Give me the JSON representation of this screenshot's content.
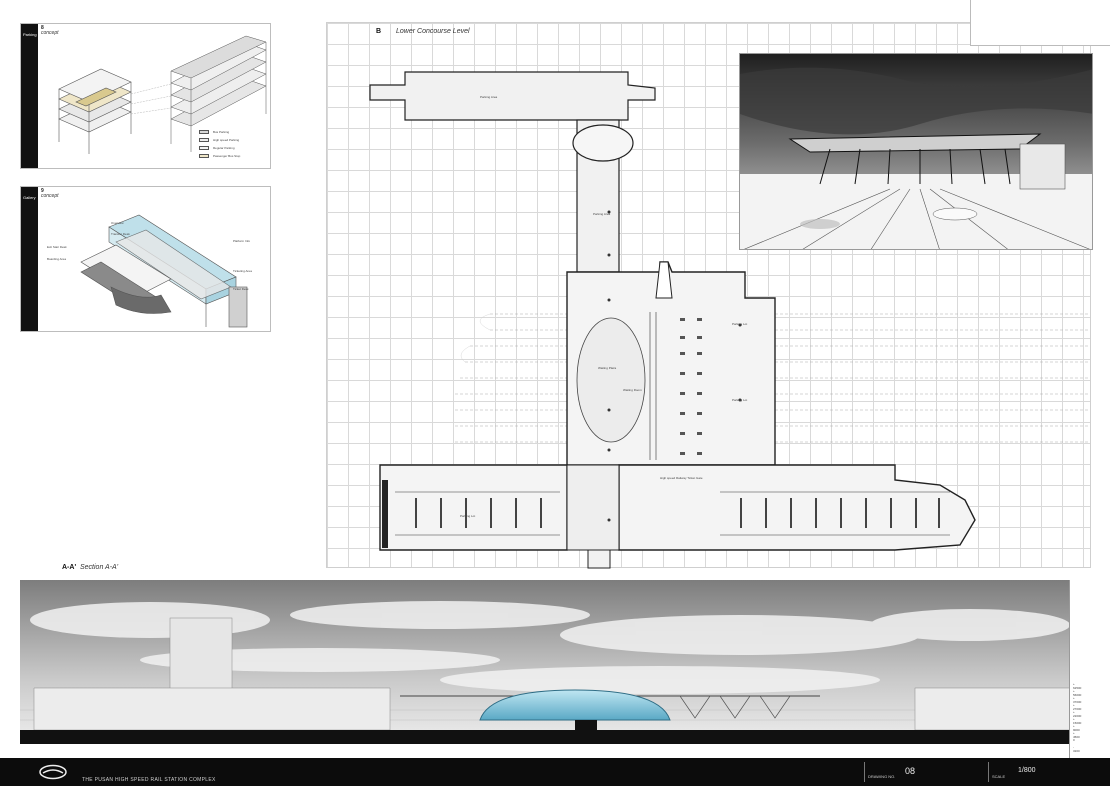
{
  "panels": {
    "parking": {
      "num": "8",
      "title": "Parking",
      "title_sub": "concept",
      "legend": [
        {
          "label": "Bus Parking",
          "color": "#d8d8d8"
        },
        {
          "label": "High speed Parking",
          "color": "#eeeeee"
        },
        {
          "label": "Regular Parking",
          "color": "#f4f4f4"
        },
        {
          "label": "Passenger Bus Stop",
          "color": "#efe6c8"
        }
      ]
    },
    "gallery": {
      "num": "9",
      "title": "Gallery",
      "title_sub": "concept",
      "labels": [
        "Overview",
        "Transfer Desk",
        "Platform Info",
        "Ticketing Area",
        "Ticket Desk",
        "Exit Stair Desk",
        "Boarding Area"
      ]
    }
  },
  "plan": {
    "symbol": "B",
    "title": "Lower Concourse Level",
    "room_labels": [
      "Parking Area",
      "Waiting Plaza",
      "Parking Area",
      "Parking Lot",
      "Parking Lot",
      "Waiting Room",
      "High speed Railway Ticket Gate",
      "Parking Lot"
    ]
  },
  "section": {
    "symbol": "A-A'",
    "title": "Section A-A'",
    "elevations": [
      "+ 62500",
      "+ 56000",
      "+ 37000",
      "+ 27000",
      "+ 22000",
      "+ 15000",
      "+ 9000",
      "+ 4500",
      "0",
      "- 3200"
    ]
  },
  "footer": {
    "project_title": "THE PUSAN HIGH SPEED RAIL STATION COMPLEX",
    "drawing_label": "DRAWING NO.",
    "drawing_no": "08",
    "scale_label": "SCALE",
    "scale_value": "1/800"
  },
  "colors": {
    "dark": "#0c0c0c",
    "grid": "#d9d9d9",
    "dome": "#7ec6dc",
    "sky": "#9a9a9a"
  }
}
